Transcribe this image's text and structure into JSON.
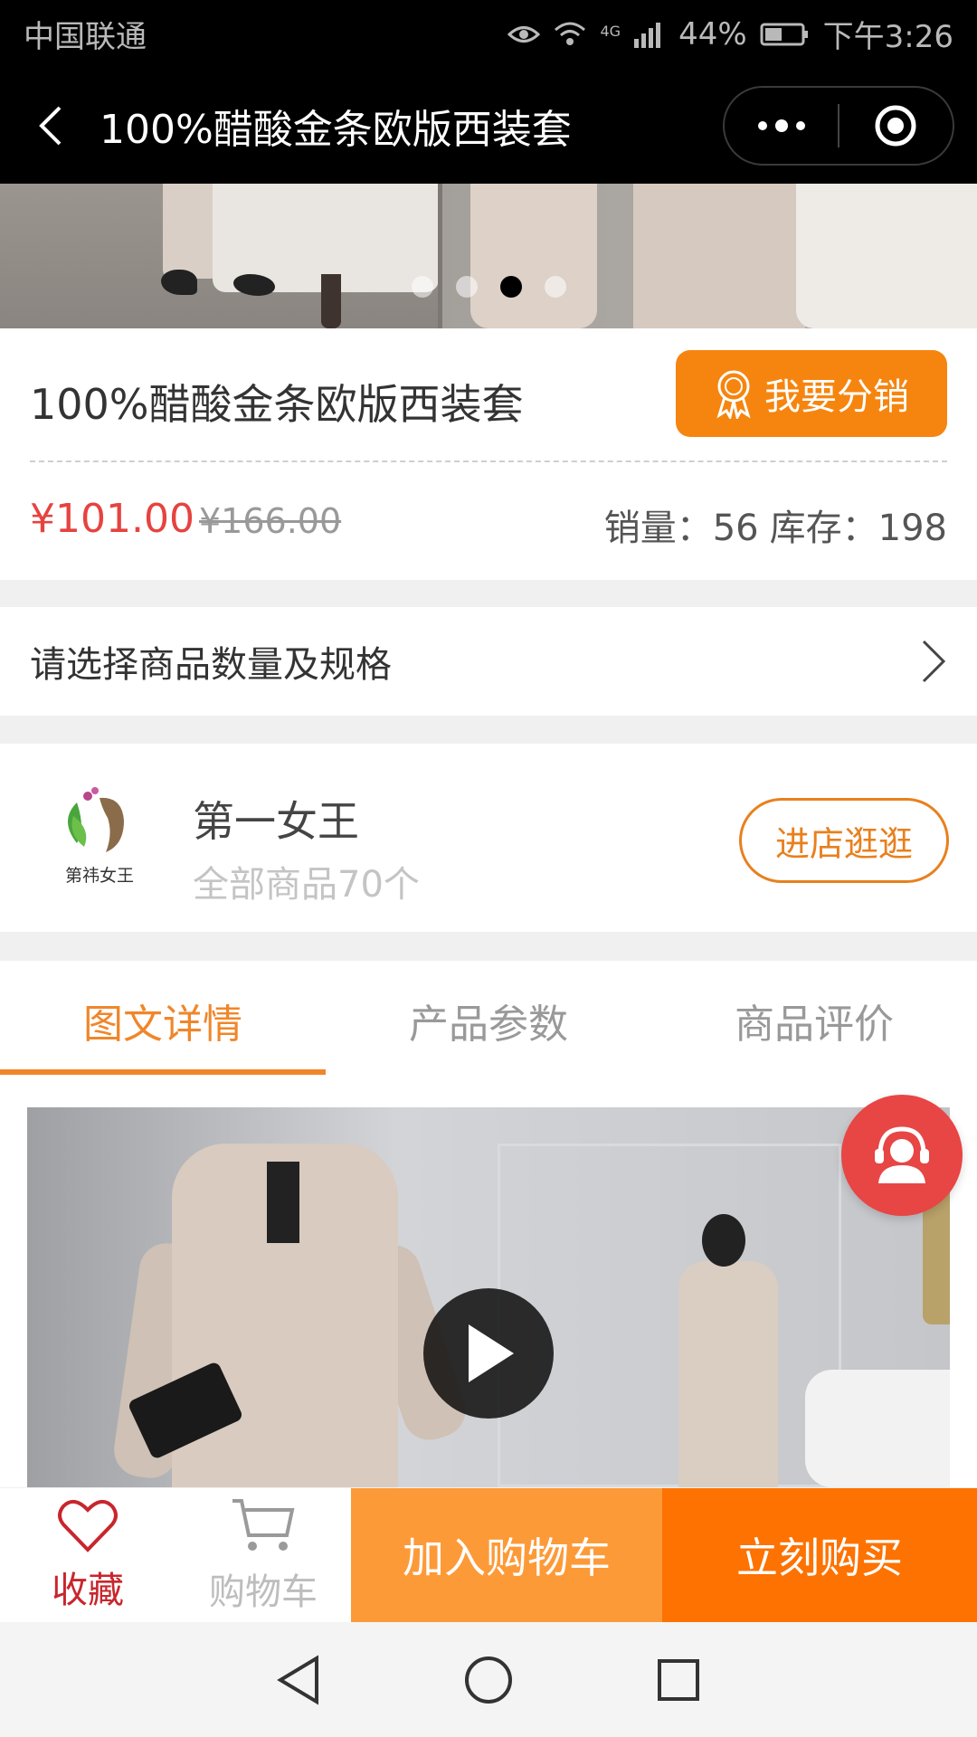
{
  "status_bar": {
    "carrier": "中国联通",
    "network": "4G",
    "battery": "44%",
    "time": "下午3:26"
  },
  "header": {
    "title": "100%醋酸金条欧版西装套"
  },
  "banner": {
    "slide_count": 4,
    "active_slide": 3
  },
  "product": {
    "name": "100%醋酸金条欧版西装套",
    "distribute_label": "我要分销",
    "price": "¥101.00",
    "original_price": "¥166.00",
    "sales": "销量：56",
    "stock": "库存：198"
  },
  "spec": {
    "label": "请选择商品数量及规格"
  },
  "shop": {
    "logo_text": "第祎女王",
    "name": "第一女王",
    "count": "全部商品70个",
    "enter_label": "进店逛逛"
  },
  "tabs": [
    {
      "label": "图文详情",
      "active": true
    },
    {
      "label": "产品参数",
      "active": false
    },
    {
      "label": "商品评价",
      "active": false
    }
  ],
  "action_bar": {
    "favorite_label": "收藏",
    "cart_label": "购物车",
    "add_cart_label": "加入购物车",
    "buy_now_label": "立刻购买"
  },
  "colors": {
    "accent": "#f6850f",
    "price_red": "#e64340",
    "add_cart": "#fd9a38",
    "buy_now": "#fd7200",
    "service": "#e84545"
  }
}
